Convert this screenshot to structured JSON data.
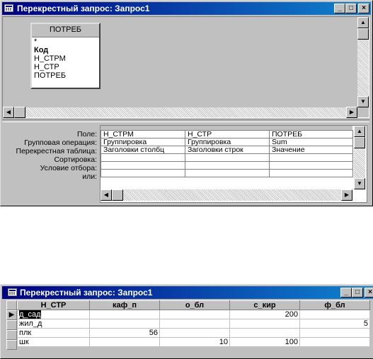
{
  "top_window": {
    "title": "Перекрестный запрос: Запрос1",
    "table_box": {
      "title": "ПОТРЕБ",
      "fields": [
        "*",
        "Код",
        "Н_СТРМ",
        "Н_СТР",
        "ПОТРЕБ"
      ],
      "bold_field": "Код"
    },
    "grid": {
      "row_labels": [
        "Поле:",
        "Групповая операция:",
        "Перекрестная таблица:",
        "Сортировка:",
        "Условие отбора:",
        "или:"
      ],
      "columns": [
        {
          "field": "Н_СТРМ",
          "group": "Группировка",
          "crosstab": "Заголовки столбц",
          "sort": "",
          "criteria": "",
          "or": ""
        },
        {
          "field": "Н_СТР",
          "group": "Группировка",
          "crosstab": "Заголовки строк",
          "sort": "",
          "criteria": "",
          "or": ""
        },
        {
          "field": "ПОТРЕБ",
          "group": "Sum",
          "crosstab": "Значение",
          "sort": "",
          "criteria": "",
          "or": ""
        }
      ]
    }
  },
  "bottom_window": {
    "title": "Перекрестный запрос: Запрос1",
    "headers": [
      "Н_СТР",
      "каф_п",
      "о_бл",
      "с_кир",
      "ф_бл"
    ],
    "rows": [
      [
        "д_сад",
        "",
        "",
        "200",
        ""
      ],
      [
        "жил_д",
        "",
        "",
        "",
        "5"
      ],
      [
        "плк",
        "56",
        "",
        "",
        ""
      ],
      [
        "шк",
        "",
        "10",
        "100",
        ""
      ]
    ],
    "current_row_marker": "▶"
  },
  "controls": {
    "minimize": "_",
    "maximize": "□",
    "close": "×",
    "arrow_up": "▲",
    "arrow_down": "▼",
    "arrow_left": "◀",
    "arrow_right": "▶"
  }
}
